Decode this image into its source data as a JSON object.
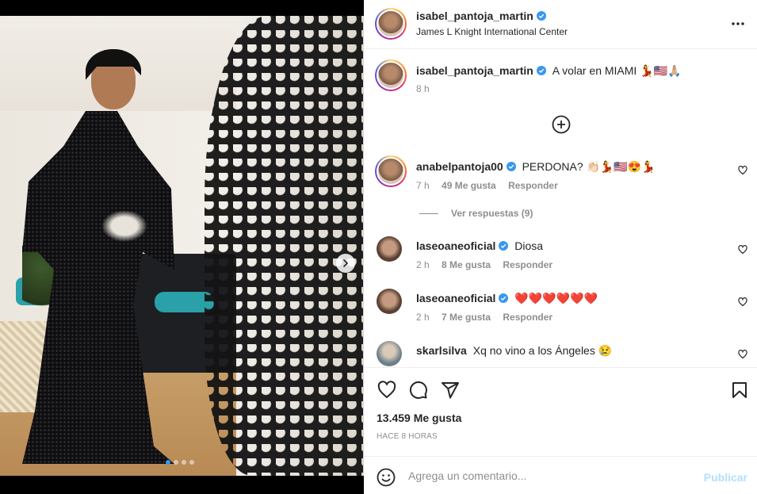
{
  "post": {
    "author": "isabel_pantoja_martin",
    "location": "James L Knight International Center",
    "caption_text": "A volar en MIAMI 💃🇺🇸🙏🏼",
    "caption_time": "8 h",
    "likes": "13.459 Me gusta",
    "time_ago": "HACE 8 HORAS"
  },
  "comments": [
    {
      "user": "anabelpantoja00",
      "verified": true,
      "text": "PERDONA? 👏🏻💃🇺🇸😍💃",
      "time": "7 h",
      "likes": "49 Me gusta",
      "reply": "Responder"
    },
    {
      "user": "laseoaneoficial",
      "verified": true,
      "text": "Diosa",
      "time": "2 h",
      "likes": "8 Me gusta",
      "reply": "Responder"
    },
    {
      "user": "laseoaneoficial",
      "verified": true,
      "text": "❤️❤️❤️❤️❤️❤️",
      "time": "2 h",
      "likes": "7 Me gusta",
      "reply": "Responder"
    },
    {
      "user": "skarlsilva",
      "verified": false,
      "text": "Xq no vino a los Ángeles 😢"
    }
  ],
  "replies_label": "Ver respuestas (9)",
  "composer": {
    "placeholder": "Agrega un comentario...",
    "publish_label": "Publicar"
  },
  "icons": {
    "more": "more-horizontal-icon",
    "verified": "verified-badge-icon",
    "add": "add-circle-icon",
    "like": "heart-icon",
    "comment": "comment-icon",
    "share": "share-icon",
    "save": "bookmark-icon",
    "emoji": "emoji-icon",
    "next": "chevron-right-icon"
  },
  "colors": {
    "verified": "#3897f0",
    "publish_disabled": "#b2dffc",
    "secondary_text": "#8e8e8e"
  }
}
